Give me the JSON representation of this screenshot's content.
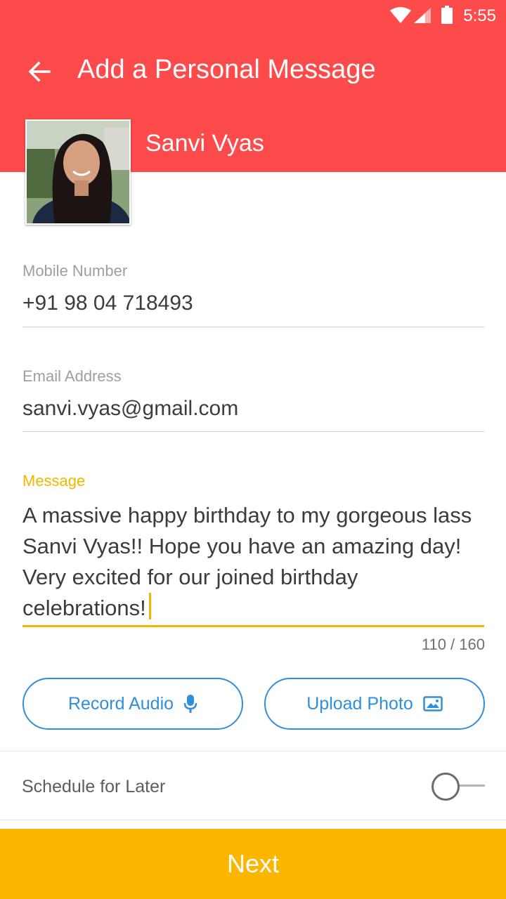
{
  "status_bar": {
    "time": "5:55"
  },
  "header": {
    "title": "Add a Personal Message",
    "back_icon": "arrow-left-icon",
    "background_color": "#fd4b4c"
  },
  "contact": {
    "name": "Sanvi Vyas"
  },
  "form": {
    "mobile": {
      "label": "Mobile Number",
      "value": "+91 98 04 718493"
    },
    "email": {
      "label": "Email Address",
      "value": "sanvi.vyas@gmail.com"
    },
    "message": {
      "label": "Message",
      "value": "A massive happy birthday to my gorgeous lass Sanvi Vyas!! Hope you have an amazing day! Very excited for our joined birthday celebrations!",
      "counter": "110 / 160",
      "accent_color": "#f5b400"
    }
  },
  "actions": {
    "record_audio": {
      "label": "Record Audio",
      "icon": "microphone-icon"
    },
    "upload_photo": {
      "label": "Upload Photo",
      "icon": "image-icon"
    },
    "accent_color": "#2f8fdd"
  },
  "schedule": {
    "label": "Schedule for Later",
    "enabled": false
  },
  "footer": {
    "next_label": "Next",
    "background_color": "#fdb600"
  }
}
